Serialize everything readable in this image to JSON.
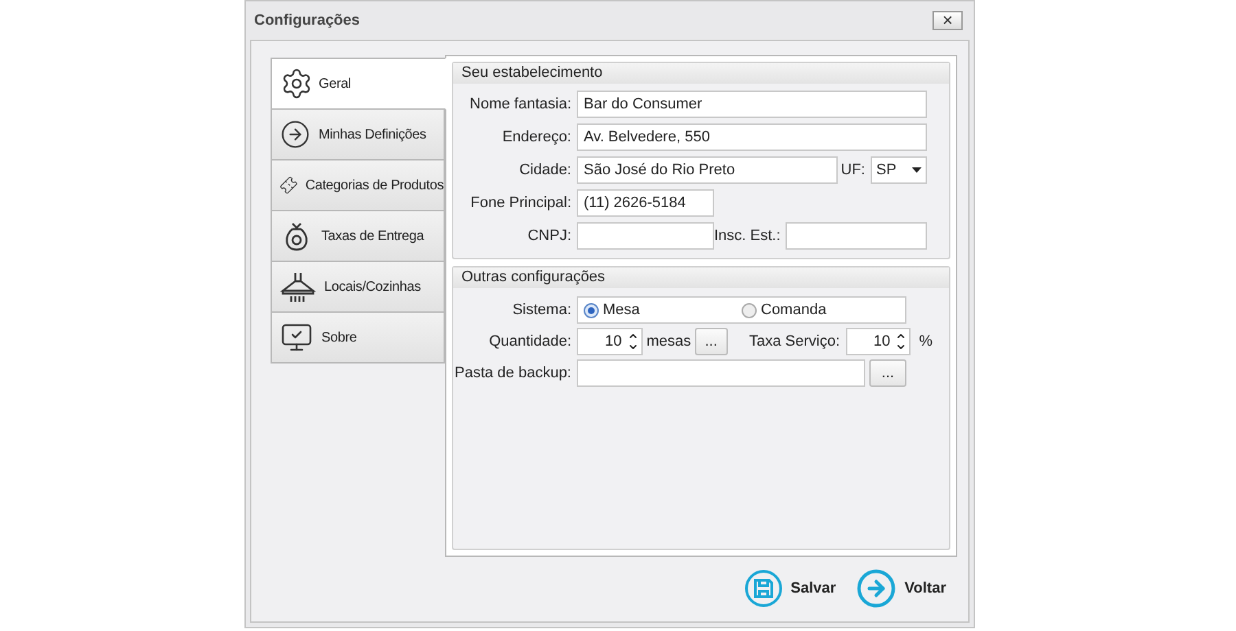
{
  "window": {
    "title": "Configurações",
    "close": "×"
  },
  "tabs": [
    {
      "label": "Geral",
      "selected": true
    },
    {
      "label": "Minhas Definições",
      "selected": false
    },
    {
      "label": "Categorias de Produtos",
      "selected": false
    },
    {
      "label": "Taxas de Entrega",
      "selected": false
    },
    {
      "label": "Locais/Cozinhas",
      "selected": false
    },
    {
      "label": "Sobre",
      "selected": false
    }
  ],
  "establishment": {
    "title": "Seu estabelecimento",
    "name": {
      "label": "Nome fantasia:",
      "value": "Bar do Consumer"
    },
    "address": {
      "label": "Endereço:",
      "value": "Av. Belvedere, 550"
    },
    "city": {
      "label": "Cidade:",
      "value": "São José do Rio Preto"
    },
    "state": {
      "label": "UF:",
      "value": "SP"
    },
    "phone": {
      "label": "Fone Principal:",
      "value": "(11) 2626-5184"
    },
    "cnpj": {
      "label": "CNPJ:"
    },
    "ie": {
      "label": "Insc. Est.:"
    }
  },
  "other": {
    "title": "Outras configurações",
    "system": {
      "label": "Sistema:",
      "options": [
        {
          "label": "Mesa",
          "selected": true
        },
        {
          "label": "Comanda",
          "selected": false
        }
      ]
    },
    "quantity": {
      "label": "Quantidade:",
      "value": "10",
      "unit": "mesas",
      "button": "..."
    },
    "service": {
      "label": "Taxa Serviço:",
      "value": "10",
      "unit": "%"
    },
    "backup": {
      "label": "Pasta de backup:",
      "button": "..."
    }
  },
  "buttons": [
    {
      "label": "Salvar"
    },
    {
      "label": "Voltar"
    }
  ]
}
